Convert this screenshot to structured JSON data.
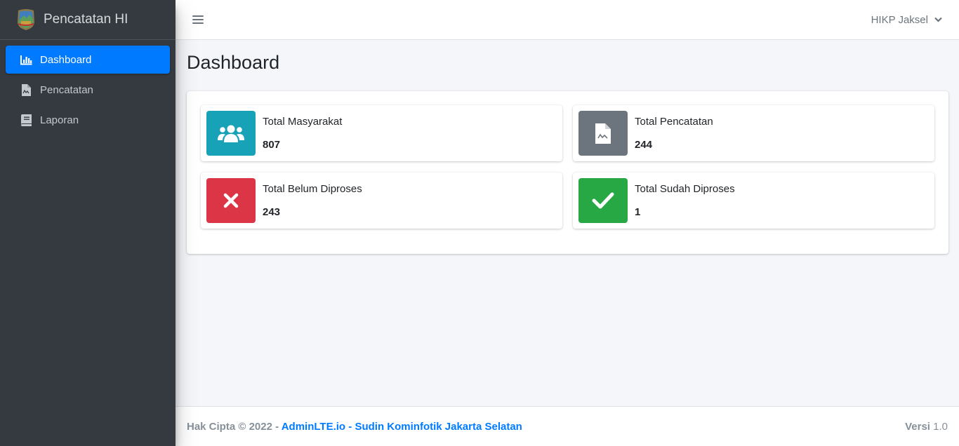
{
  "brand": {
    "title": "Pencatatan HI"
  },
  "sidebar": {
    "items": [
      {
        "label": "Dashboard",
        "icon": "chart-bar-icon",
        "active": true
      },
      {
        "label": "Pencatatan",
        "icon": "file-signature-icon",
        "active": false
      },
      {
        "label": "Laporan",
        "icon": "book-icon",
        "active": false
      }
    ]
  },
  "navbar": {
    "user": "HIKP Jaksel"
  },
  "page": {
    "title": "Dashboard"
  },
  "stats": [
    {
      "label": "Total Masyarakat",
      "value": "807",
      "icon": "users-icon",
      "color": "#17a2b8"
    },
    {
      "label": "Total Pencatatan",
      "value": "244",
      "icon": "file-contract-icon",
      "color": "#6c757d"
    },
    {
      "label": "Total Belum Diproses",
      "value": "243",
      "icon": "times-icon",
      "color": "#dc3545"
    },
    {
      "label": "Total Sudah Diproses",
      "value": "1",
      "icon": "check-icon",
      "color": "#28a745"
    }
  ],
  "footer": {
    "copyright": "Hak Cipta © 2022 - ",
    "link1": "AdminLTE.io",
    "sep": " - ",
    "link2": "Sudin Kominfotik Jakarta Selatan",
    "version_label": "Versi",
    "version": "1.0"
  },
  "colors": {
    "primary": "#007bff",
    "sidebar": "#343a40"
  }
}
